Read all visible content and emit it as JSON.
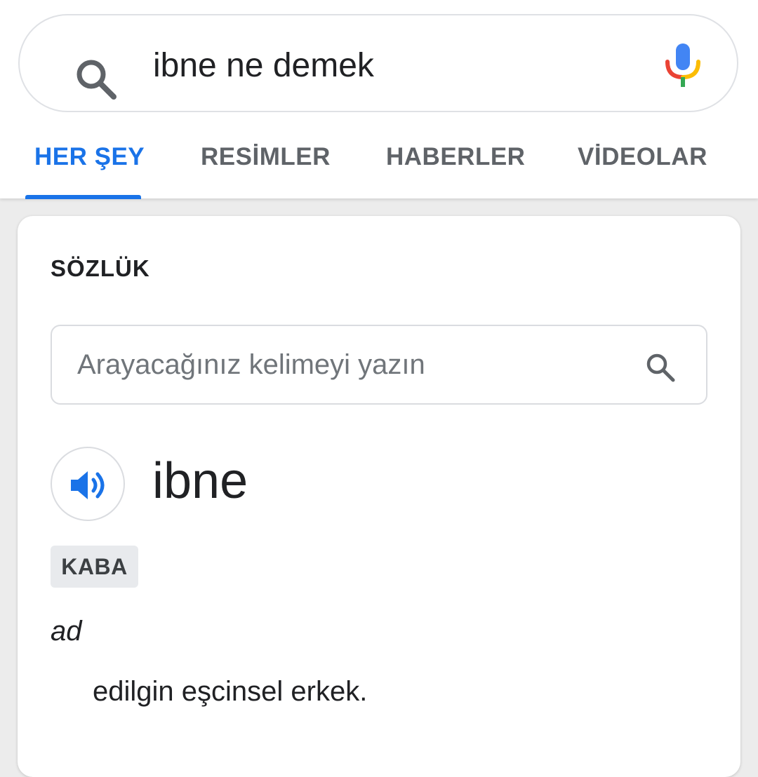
{
  "search": {
    "query": "ibne ne demek"
  },
  "tabs": [
    {
      "label": "HER ŞEY",
      "active": true
    },
    {
      "label": "RESİMLER",
      "active": false
    },
    {
      "label": "HABERLER",
      "active": false
    },
    {
      "label": "VİDEOLAR",
      "active": false
    }
  ],
  "dictionary": {
    "title": "SÖZLÜK",
    "search_placeholder": "Arayacağınız kelimeyi yazın",
    "word": "ibne",
    "label": "KABA",
    "part_of_speech": "ad",
    "definition": "edilgin eşcinsel erkek."
  },
  "icons": {
    "search": "search-icon",
    "mic": "mic-icon",
    "speaker": "speaker-icon"
  },
  "colors": {
    "accent": "#1a73e8",
    "tab_inactive": "#5f6368",
    "text": "#202124",
    "badge_bg": "#e8eaed",
    "page_bg": "#ececec"
  }
}
